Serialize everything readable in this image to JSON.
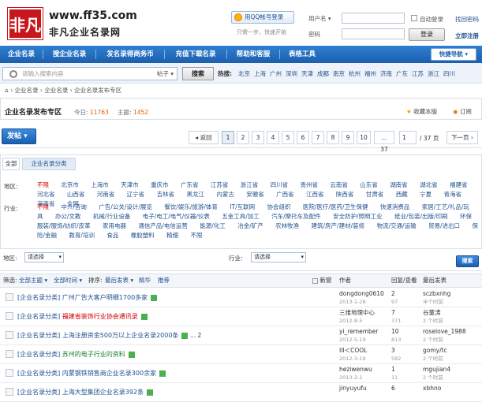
{
  "brand": {
    "url": "www.ff35.com",
    "name": "非凡企业名录网",
    "logo_text": "非凡"
  },
  "login": {
    "qq_button": "用QQ帐号登录",
    "qq_note": "只需一步，快速开始",
    "user_label": "用户名",
    "user_select": "▾",
    "pass_label": "密码",
    "auto_login": "自动登录",
    "find_password": "找回密码",
    "login_button": "登录",
    "register": "立即注册"
  },
  "nav": {
    "items": [
      "企业名录",
      "搜企业名录",
      "发名录得商务币",
      "充值下载名录",
      "帮助和客服",
      "表格工具"
    ],
    "quick": "快捷导航"
  },
  "search": {
    "placeholder": "请输入搜索内容",
    "scope": "帖子",
    "button": "搜索",
    "hot_label": "热搜:",
    "hot": [
      "北京",
      "上海",
      "广州",
      "深圳",
      "天津",
      "成都",
      "南京",
      "杭州",
      "福州",
      "济南",
      "广东",
      "江苏",
      "浙江",
      "四川"
    ]
  },
  "breadcrumb": [
    "企业名录",
    "企业名录",
    "企业名录发布专区"
  ],
  "zone": {
    "title": "企业名录发布专区",
    "today_label": "今日:",
    "today": "11763",
    "topics_label": "主题:",
    "topics": "1452",
    "favorite": "收藏本版",
    "subscribe": "订阅"
  },
  "pager": {
    "post": "发帖",
    "prev": "◂ 返回",
    "pages": [
      "1",
      "2",
      "3",
      "4",
      "5",
      "6",
      "7",
      "8",
      "9",
      "10",
      "... 37"
    ],
    "current_page": "1",
    "total": "/ 37 页",
    "next": "下一页"
  },
  "tabs": [
    "全部",
    "企业名录分类"
  ],
  "filter": {
    "region_label": "地区:",
    "regions": [
      "不限",
      "北京市",
      "上海市",
      "天津市",
      "重庆市",
      "广东省",
      "江苏省",
      "浙江省",
      "四川省",
      "贵州省",
      "云南省",
      "山东省",
      "湖南省",
      "湖北省",
      "福建省",
      "河北省",
      "山西省",
      "河南省",
      "辽宁省",
      "吉林省",
      "黑龙江",
      "内蒙古",
      "安徽省",
      "广西省",
      "江西省",
      "陕西省",
      "甘肃省",
      "西藏",
      "宁夏",
      "青海省",
      "海南省",
      "全国"
    ],
    "industry_label": "行业:",
    "industries": [
      "不限",
      "中介/咨询",
      "广告/公关/设计/展览",
      "餐饮/娱乐/旅游/体育",
      "IT/互联网",
      "协会组织",
      "医院/医疗/医药/卫生保健",
      "快速消费品",
      "家居/工艺/礼品/玩具",
      "办公/文教",
      "机械/行业设备",
      "电子/电工/电气/仪器/仪表",
      "五金工具/加工",
      "汽车/摩托车及配件",
      "安全防护/照明工业",
      "纸业/包装/出版/印刷",
      "环保",
      "服装/服饰/纺织/皮革",
      "家用电器",
      "通信产品/电信运营",
      "能源/化工",
      "冶金/矿产",
      "农林牧渔",
      "建筑/房产/建材/装修",
      "物流/交通/运输",
      "贸易/进出口",
      "保险/金融",
      "教育/培训",
      "食品",
      "橡胶塑料",
      "精细",
      "不限"
    ]
  },
  "selects": {
    "region_label": "地区:",
    "region_value": "请选择",
    "industry_label": "行业:",
    "industry_value": "请选择",
    "search": "搜索"
  },
  "table": {
    "filter_label": "筛选:",
    "all_topics": "全部主题",
    "all_time": "全部时间",
    "sort_label": "排序:",
    "sort": "最后发表",
    "mode1": "精华",
    "mode2": "推荐",
    "new_window": "新窗",
    "col_author": "作者",
    "col_reply": "回复/查看",
    "col_last": "最后发表",
    "rows": [
      {
        "category": "[企业名录分类]",
        "title": "广州厂告大客户明细1700多家",
        "color": "blue",
        "pages": "",
        "author": "dongdong0610",
        "date": "2013-1-28",
        "reply": "2",
        "views": "97",
        "last_user": "sczbxnhg",
        "last_time": "半个时前"
      },
      {
        "category": "[企业名录分类]",
        "title": "福建省装饰行业协会通讯录",
        "color": "red",
        "pages": "",
        "author": "三维地理中心",
        "date": "2012-8-5",
        "reply": "7",
        "views": "371",
        "last_user": "谷童涛",
        "last_time": "2 个时前"
      },
      {
        "category": "[企业名录分类]",
        "title": "上海注册资金500万以上企业名录2000条",
        "color": "blue",
        "pages": "... 2",
        "author": "yi_remember",
        "date": "2012-5-19",
        "reply": "10",
        "views": "813",
        "last_user": "roselove_1988",
        "last_time": "2 个时前"
      },
      {
        "category": "[企业名录分类]",
        "title": "苏州的电子行业的资料",
        "color": "green",
        "pages": "",
        "author": "III＜COOL",
        "date": "2012-3-19",
        "reply": "3",
        "views": "582",
        "last_user": "gomy/tc",
        "last_time": "2 个时前"
      },
      {
        "category": "[企业名录分类]",
        "title": "内蒙钢铁销售商企业名录300余家",
        "color": "blue",
        "pages": "",
        "author": "heziwenwu",
        "date": "2013-2-1",
        "reply": "1",
        "views": "11",
        "last_user": "mgujian4",
        "last_time": "2 个时前"
      },
      {
        "category": "[企业名录分类]",
        "title": "上海大型集团企业名录392条",
        "color": "blue",
        "pages": "",
        "author": "jinyuyufu",
        "date": "",
        "reply": "6",
        "views": "",
        "last_user": "xbhno",
        "last_time": ""
      }
    ]
  }
}
